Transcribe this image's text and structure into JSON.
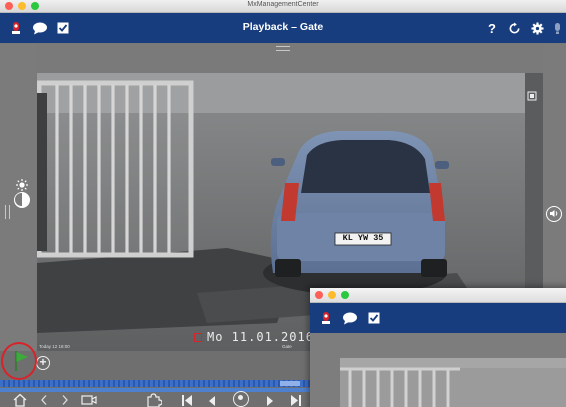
{
  "app": {
    "window_title": "MxManagementCenter"
  },
  "toolbar": {
    "title": "Playback – Gate",
    "help_label": "?"
  },
  "icons": {
    "camera": "camera-icon",
    "chat": "chat-icon",
    "check": "checkbox-icon",
    "help": "help-icon",
    "refresh": "refresh-icon",
    "settings": "gear-icon",
    "sensor": "sensor-icon",
    "brightness": "brightness-icon",
    "speaker": "speaker-icon",
    "home": "home-icon",
    "back": "back-arrow-icon",
    "forward": "forward-arrow-icon",
    "video": "video-icon",
    "puzzle": "puzzle-icon",
    "skip_start": "skip-to-start-icon",
    "step_back": "step-back-icon",
    "play": "play-icon",
    "step_forward": "step-forward-icon",
    "skip_end": "skip-to-end-icon",
    "flag": "flag-icon",
    "add": "add-icon"
  },
  "video": {
    "timestamp": "Mo 11.01.2016",
    "plate": "KL YW 35",
    "overlay_small_left": "Today 12 18:00",
    "overlay_small_right": "Gate"
  },
  "colors": {
    "toolbar": "#173d7f",
    "accent_red": "#d8232a",
    "highlight_circle": "#d8232a",
    "flag": "#3cab3c",
    "timeline": "#3b6fc9"
  }
}
